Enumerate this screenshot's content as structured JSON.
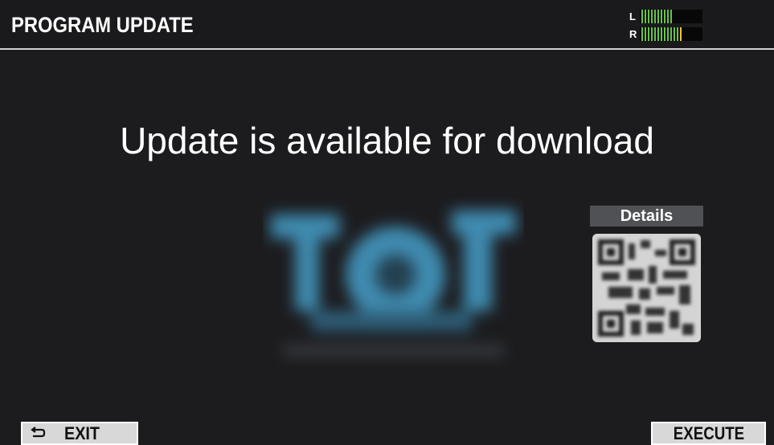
{
  "header": {
    "title": "PROGRAM UPDATE",
    "meter": {
      "left_label": "L",
      "right_label": "R",
      "left_level": 0.55,
      "right_level": 0.7,
      "colors": {
        "green": "#67c34a",
        "yellow": "#f0c430",
        "track": "#080808"
      }
    }
  },
  "main": {
    "headline": "Update is available for download",
    "details_label": "Details",
    "logo": {
      "description_icon": "blurred-logo-image",
      "color": "#3f8bb0"
    },
    "qr_icon": "qr-code-icon"
  },
  "softkeys": {
    "exit_label": "EXIT",
    "exit_icon": "return-arrow-icon",
    "execute_label": "EXECUTE"
  },
  "colors": {
    "background": "#1c1c1f",
    "header_rule": "#d0d0d0",
    "softkey_bg": "#d8d8d8",
    "details_bg": "#505155"
  }
}
